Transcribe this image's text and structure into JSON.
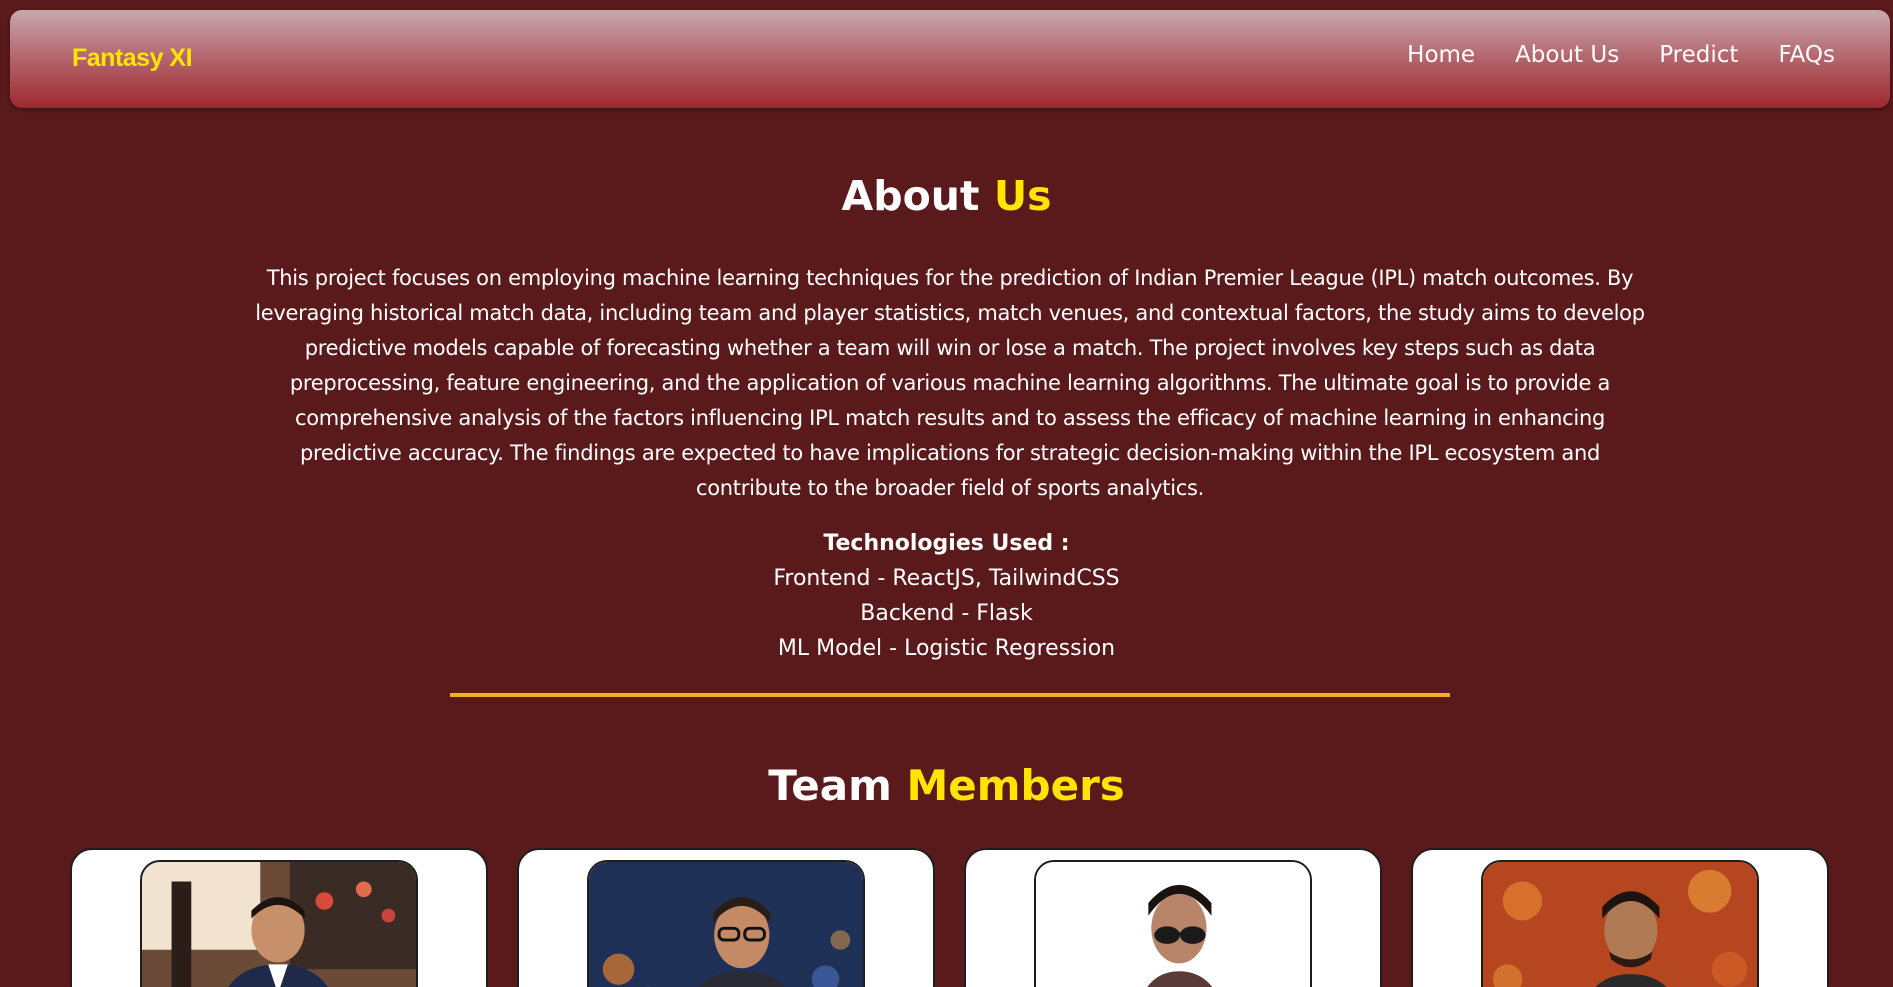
{
  "navbar": {
    "brand": "Fantasy XI",
    "links": [
      "Home",
      "About Us",
      "Predict",
      "FAQs"
    ]
  },
  "about": {
    "heading_white": "About",
    "heading_accent": "Us",
    "description": "This project focuses on employing machine learning techniques for the prediction of Indian Premier League (IPL) match outcomes. By leveraging historical match data, including team and player statistics, match venues, and contextual factors, the study aims to develop predictive models capable of forecasting whether a team will win or lose a match. The project involves key steps such as data preprocessing, feature engineering, and the application of various machine learning algorithms. The ultimate goal is to provide a comprehensive analysis of the factors influencing IPL match results and to assess the efficacy of machine learning in enhancing predictive accuracy. The findings are expected to have implications for strategic decision-making within the IPL ecosystem and contribute to the broader field of sports analytics."
  },
  "technologies": {
    "title": "Technologies Used :",
    "frontend": "Frontend - ReactJS, TailwindCSS",
    "backend": "Backend - Flask",
    "model": "ML Model - Logistic Regression"
  },
  "team": {
    "heading_white": "Team",
    "heading_accent": "Members",
    "members": [
      {
        "photo": "member-photo-1"
      },
      {
        "photo": "member-photo-2"
      },
      {
        "photo": "member-photo-3"
      },
      {
        "photo": "member-photo-4"
      }
    ]
  },
  "colors": {
    "background": "#5a1a1b",
    "accent": "#ffe500",
    "divider": "#f3b21b"
  }
}
